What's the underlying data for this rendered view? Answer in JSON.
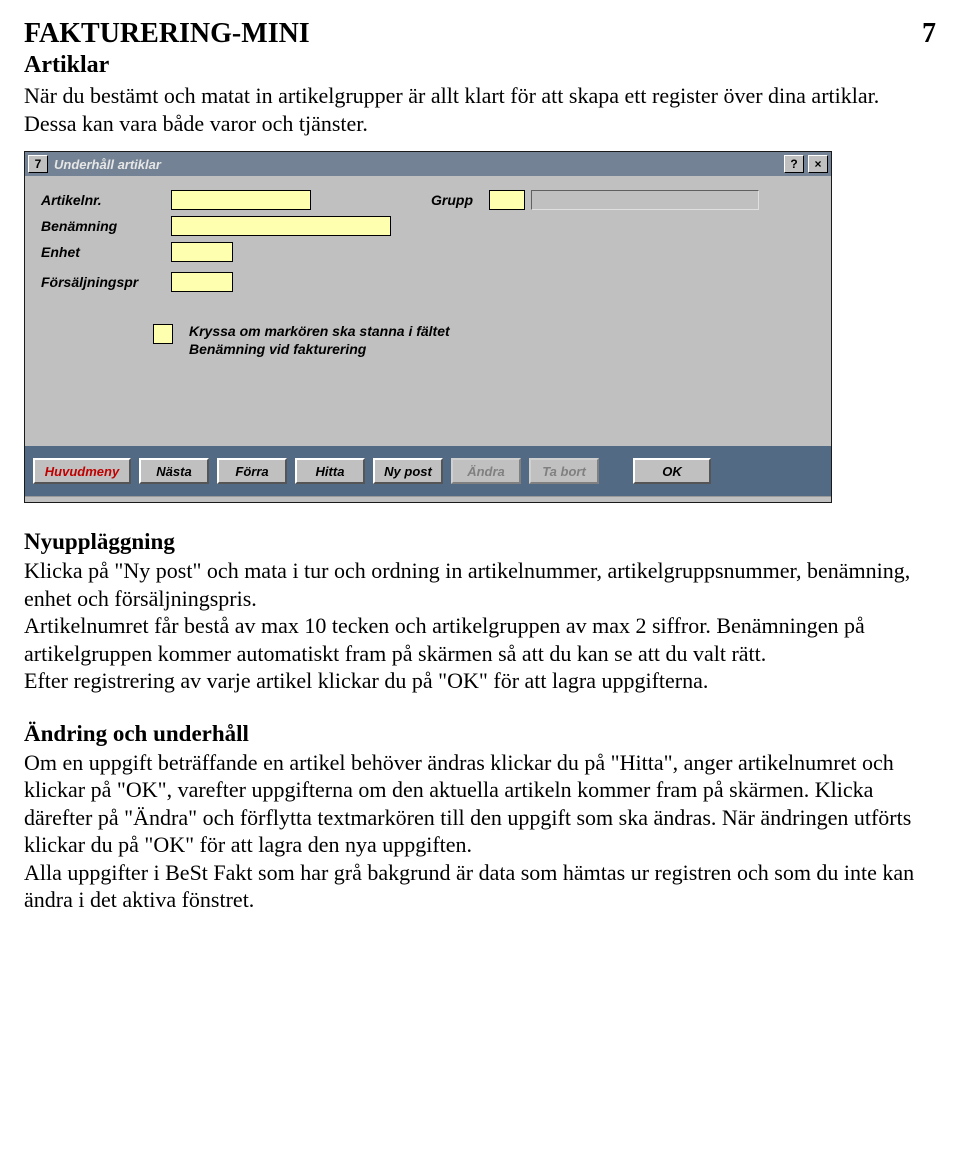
{
  "page": {
    "title": "FAKTURERING-MINI",
    "page_number": "7",
    "section_title": "Artiklar",
    "intro": "När du bestämt och matat in artikelgrupper är allt klart för att skapa ett register över dina artiklar. Dessa kan vara både varor och tjänster."
  },
  "window": {
    "sysicon": "7",
    "title": "Underhåll artiklar",
    "help": "?",
    "close": "×",
    "labels": {
      "artikelnr": "Artikelnr.",
      "grupp": "Grupp",
      "benamning": "Benämning",
      "enhet": "Enhet",
      "forsaljningspr": "Försäljningspr"
    },
    "checkbox_text_line1": "Kryssa om markören ska stanna i fältet",
    "checkbox_text_line2": "Benämning vid fakturering",
    "buttons": {
      "huvudmeny": "Huvudmeny",
      "nasta": "Nästa",
      "forra": "Förra",
      "hitta": "Hitta",
      "ny_post": "Ny post",
      "andra": "Ändra",
      "ta_bort": "Ta bort",
      "ok": "OK"
    }
  },
  "sections": {
    "s1_head": "Nyuppläggning",
    "s1_body": "Klicka på \"Ny post\" och mata i tur och ordning in artikelnummer, artikelgruppsnummer, benämning, enhet och försäljningspris.\nArtikelnumret får bestå av max 10 tecken och artikelgruppen av max 2 siffror. Benämningen på artikelgruppen kommer automatiskt fram på skärmen så att du kan se att du valt rätt.\nEfter registrering av varje artikel klickar du på \"OK\" för att lagra uppgifterna.",
    "s2_head": "Ändring och underhåll",
    "s2_body": "Om en uppgift beträffande en artikel behöver ändras klickar du på \"Hitta\", anger artikelnumret och klickar på \"OK\", varefter uppgifterna om den aktuella artikeln kommer fram på skärmen. Klicka därefter på \"Ändra\" och förflytta textmarkören till den uppgift som ska ändras. När ändringen utförts klickar du på \"OK\" för att lagra den nya uppgiften.\nAlla uppgifter i BeSt Fakt som har grå bakgrund är data som hämtas ur registren och som du inte kan ändra i det aktiva fönstret."
  }
}
